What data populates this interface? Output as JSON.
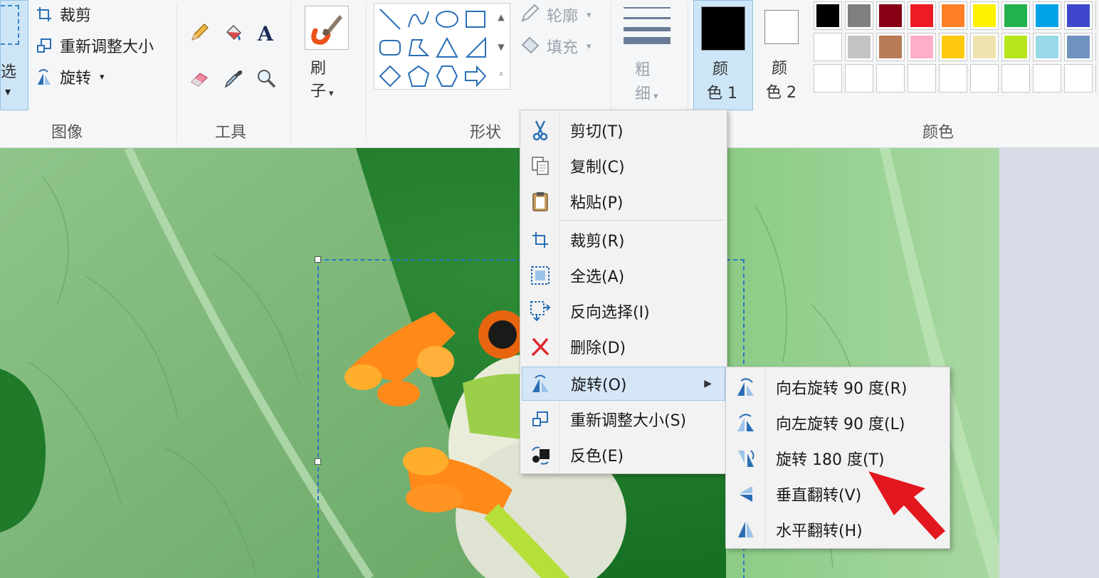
{
  "ribbon": {
    "image_group": {
      "label": "图像",
      "select_partial_label": "选",
      "crop": "裁剪",
      "resize": "重新调整大小",
      "rotate": "旋转"
    },
    "tools_group": {
      "label": "工具"
    },
    "brush": {
      "label_line1": "刷",
      "label_line2": "子"
    },
    "shapes_group": {
      "label": "形状",
      "outline": "轮廓",
      "fill": "填充"
    },
    "size": {
      "label_line1": "粗",
      "label_line2": "细"
    },
    "color1": {
      "line1": "颜",
      "line2": "色 1",
      "value": "#000000"
    },
    "color2": {
      "line1": "颜",
      "line2": "色 2",
      "value": "#ffffff"
    },
    "colors_group": {
      "label": "颜色",
      "palette_row1": [
        "#000000",
        "#7f7f7f",
        "#880015",
        "#ed1c24",
        "#ff7f27",
        "#fff200",
        "#22b14c",
        "#00a2e8",
        "#3f48cc"
      ],
      "palette_row2": [
        "#ffffff",
        "#c3c3c3",
        "#b97a57",
        "#ffaec9",
        "#ffc90e",
        "#efe4b0",
        "#b5e61d",
        "#99d9ea",
        "#7092be"
      ]
    }
  },
  "context_menu": {
    "items": [
      {
        "label": "剪切(T)",
        "icon": "scissors-icon"
      },
      {
        "label": "复制(C)",
        "icon": "copy-icon"
      },
      {
        "label": "粘贴(P)",
        "icon": "paste-icon"
      },
      {
        "label": "裁剪(R)",
        "icon": "crop-icon"
      },
      {
        "label": "全选(A)",
        "icon": "select-all-icon"
      },
      {
        "label": "反向选择(I)",
        "icon": "invert-selection-icon"
      },
      {
        "label": "删除(D)",
        "icon": "delete-icon"
      },
      {
        "label": "旋转(O)",
        "icon": "rotate-icon"
      },
      {
        "label": "重新调整大小(S)",
        "icon": "resize-icon"
      },
      {
        "label": "反色(E)",
        "icon": "invert-color-icon"
      }
    ]
  },
  "rotate_submenu": {
    "items": [
      {
        "label": "向右旋转 90 度(R)",
        "icon": "rotate-right-icon"
      },
      {
        "label": "向左旋转 90 度(L)",
        "icon": "rotate-left-icon"
      },
      {
        "label": "旋转 180 度(T)",
        "icon": "rotate-180-icon"
      },
      {
        "label": "垂直翻转(V)",
        "icon": "flip-vertical-icon"
      },
      {
        "label": "水平翻转(H)",
        "icon": "flip-horizontal-icon"
      }
    ]
  },
  "accent_colors": {
    "highlight": "#d5e6f6",
    "selection_border": "#2a78c4",
    "annotation_arrow": "#e3171f"
  }
}
